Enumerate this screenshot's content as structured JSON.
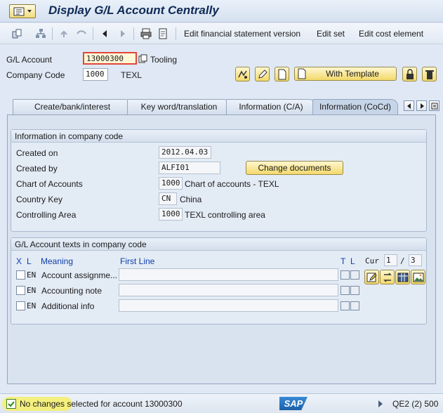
{
  "title": "Display G/L Account Centrally",
  "toolbar": {
    "links": [
      "Edit financial statement version",
      "Edit set",
      "Edit cost element"
    ]
  },
  "header": {
    "gl_account_label": "G/L Account",
    "gl_account_value": "13000300",
    "gl_account_desc": "Tooling",
    "company_code_label": "Company Code",
    "company_code_value": "1000",
    "company_code_desc": "TEXL",
    "with_template_label": "With Template"
  },
  "tabs": [
    "Create/bank/interest",
    "Key word/translation",
    "Information (C/A)",
    "Information (CoCd)"
  ],
  "info_group": {
    "title": "Information in company code",
    "created_on_label": "Created on",
    "created_on_value": "2012.04.03",
    "created_by_label": "Created by",
    "created_by_value": "ALFI01",
    "change_documents_label": "Change documents",
    "chart_label": "Chart of Accounts",
    "chart_value": "1000",
    "chart_desc": "Chart of accounts - TEXL",
    "country_label": "Country Key",
    "country_value": "CN",
    "country_desc": "China",
    "controlling_label": "Controlling Area",
    "controlling_value": "1000",
    "controlling_desc": "TEXL controlling area"
  },
  "texts_group": {
    "title": "G/L Account texts in company code",
    "col_x": "X",
    "col_l": "L",
    "col_meaning": "Meaning",
    "col_first_line": "First Line",
    "col_t": "T",
    "col_l2": "L",
    "cur_label": "Cur",
    "cur_value": "1",
    "cur_sep": "/",
    "cur_total": "3",
    "rows": [
      {
        "lang": "EN",
        "meaning": "Account assignme..."
      },
      {
        "lang": "EN",
        "meaning": "Accounting note"
      },
      {
        "lang": "EN",
        "meaning": "Additional info"
      }
    ]
  },
  "status": {
    "message": "No changes selected for account 13000300",
    "brand": "SAP",
    "system": "QE2 (2) 500"
  }
}
